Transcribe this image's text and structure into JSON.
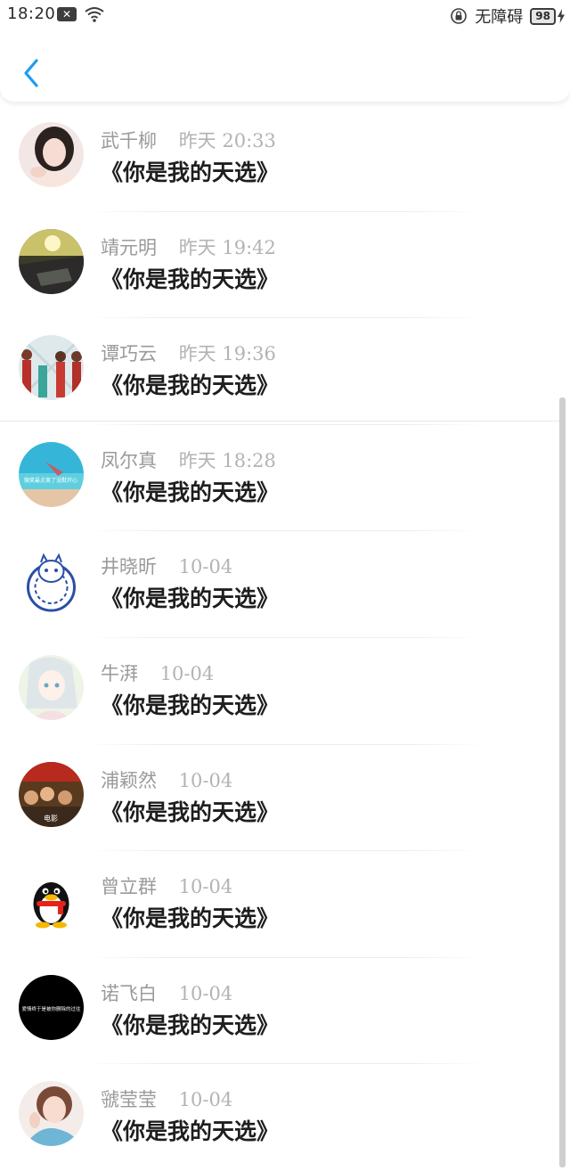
{
  "status_bar": {
    "time": "18:20",
    "accessibility_label": "无障碍",
    "battery_level": "98"
  },
  "header": {
    "back_icon": "chevron-left-icon",
    "accent_color": "#1e9bf0"
  },
  "items": [
    {
      "name": "武千柳",
      "time": "昨天 20:33",
      "message": "《你是我的天选》"
    },
    {
      "name": "靖元明",
      "time": "昨天 19:42",
      "message": "《你是我的天选》"
    },
    {
      "name": "谭巧云",
      "time": "昨天 19:36",
      "message": "《你是我的天选》"
    },
    {
      "name": "凤尔真",
      "time": "昨天 18:28",
      "message": "《你是我的天选》",
      "avatar_text": "微笑最点美了没默开心"
    },
    {
      "name": "井晓昕",
      "time": "10-04",
      "message": "《你是我的天选》"
    },
    {
      "name": "牛湃",
      "time": "10-04",
      "message": "《你是我的天选》"
    },
    {
      "name": "浦颖然",
      "time": "10-04",
      "message": "《你是我的天选》",
      "avatar_text": "电影"
    },
    {
      "name": "曾立群",
      "time": "10-04",
      "message": "《你是我的天选》"
    },
    {
      "name": "诺飞白",
      "time": "10-04",
      "message": "《你是我的天选》",
      "avatar_text": "爱情终于是被你删除的过往"
    },
    {
      "name": "虢莹莹",
      "time": "10-04",
      "message": "《你是我的天选》"
    }
  ]
}
